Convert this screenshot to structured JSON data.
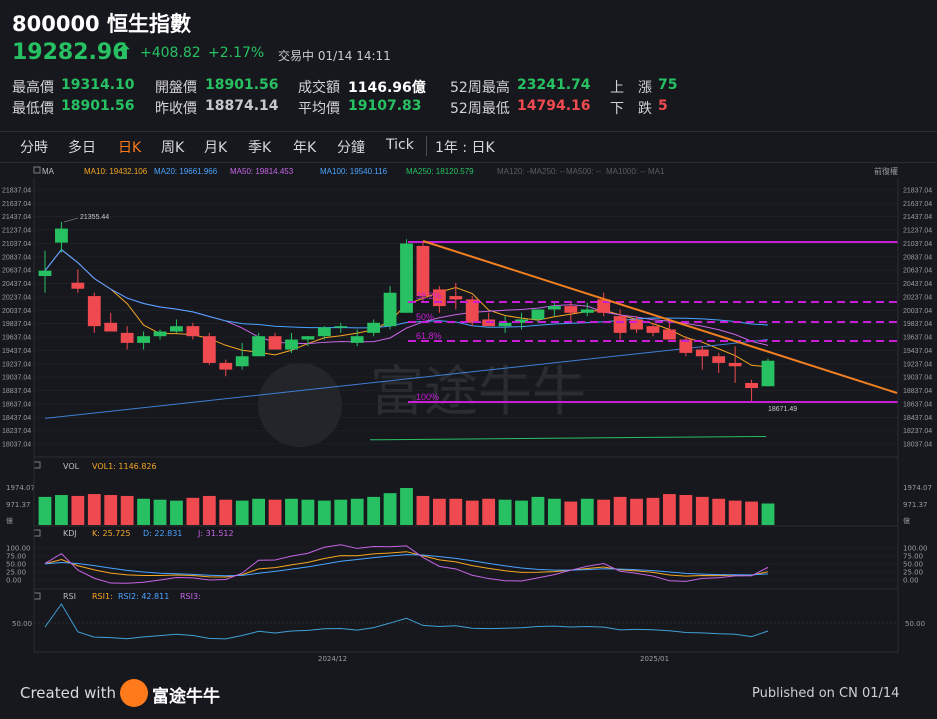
{
  "header": {
    "code": "800000",
    "name": "恒生指數",
    "price": "19282.96",
    "change": "+408.82",
    "change_pct": "+2.17%",
    "status": "交易中 01/14 14:11"
  },
  "stats": {
    "high_label": "最高價",
    "high": "19314.10",
    "low_label": "最低價",
    "low": "18901.56",
    "open_label": "開盤價",
    "open": "18901.56",
    "prev_label": "昨收價",
    "prev": "18874.14",
    "turnover_label": "成交額",
    "turnover": "1146.96億",
    "avg_label": "平均價",
    "avg": "19107.83",
    "w52h_label": "52周最高",
    "w52h": "23241.74",
    "w52l_label": "52周最低",
    "w52l": "14794.16",
    "up_label": "上　漲",
    "up": "75",
    "down_label": "下　跌",
    "down": "5"
  },
  "tabs": [
    "分時",
    "多日",
    "日K",
    "周K",
    "月K",
    "季K",
    "年K",
    "分鐘",
    "Tick"
  ],
  "active_tab": "日K",
  "range_label": "1年 : 日K",
  "indicators": {
    "ma_title": "MA",
    "ma10": "MA10: 19432.106",
    "ma20": "MA20: 19661.966",
    "ma50": "MA50: 19814.453",
    "ma100": "MA100: 19540.116",
    "ma250": "MA250: 18120.579",
    "ma120": "MA120: --",
    "ma250b": "MA250: --",
    "ma500": "MA500: --",
    "ma1000": "MA1000: --",
    "ma_extra": "MA1",
    "fq": "前復權",
    "vol_title": "VOL",
    "vol1": "VOL1: 1146.826",
    "kdj_title": "KDJ",
    "k": "K: 25.725",
    "d": "D: 22.831",
    "j": "J: 31.512",
    "rsi_title": "RSI",
    "rsi1": "RSI1:",
    "rsi2": "RSI2: 42.811",
    "rsi3": "RSI3:"
  },
  "price_ticks": [
    "21837.04",
    "21637.04",
    "21437.04",
    "21237.04",
    "21037.04",
    "20837.04",
    "20637.04",
    "20437.04",
    "20237.04",
    "20037.04",
    "19837.04",
    "19637.04",
    "19437.04",
    "19237.04",
    "19037.04",
    "18837.04",
    "18637.04",
    "18437.04",
    "18237.04",
    "18037.04"
  ],
  "vol_ticks": [
    "1974.07",
    "971.37",
    "億"
  ],
  "kdj_ticks": [
    "100.00",
    "75.00",
    "50.00",
    "25.00",
    "0.00"
  ],
  "rsi_ticks": [
    "50.00"
  ],
  "date_labels": [
    "2024/12",
    "2025/01"
  ],
  "fib_labels": [
    "38.2%",
    "50%",
    "61.8%",
    "100%"
  ],
  "annotations": {
    "high_mark": "21355.44",
    "low_mark": "18671.49"
  },
  "watermark": "富途牛牛",
  "footer": {
    "created": "Created with",
    "brand": "富途牛牛",
    "published": "Published on CN 01/14"
  },
  "colors": {
    "up": "#ef4a4f",
    "down": "#27c062",
    "accent": "#ff7a1a",
    "fib": "#c81ed6"
  },
  "chart_data": {
    "type": "candlestick",
    "ohlc": [
      [
        20550,
        20930,
        20300,
        20630
      ],
      [
        21050,
        21360,
        20900,
        21260
      ],
      [
        20450,
        20650,
        20300,
        20360
      ],
      [
        20250,
        20300,
        19700,
        19800
      ],
      [
        19850,
        20000,
        19780,
        19720
      ],
      [
        19700,
        19800,
        19450,
        19550
      ],
      [
        19550,
        19720,
        19450,
        19650
      ],
      [
        19650,
        19750,
        19600,
        19720
      ],
      [
        19720,
        19900,
        19700,
        19800
      ],
      [
        19800,
        19850,
        19600,
        19650
      ],
      [
        19650,
        19700,
        19220,
        19250
      ],
      [
        19250,
        19300,
        19050,
        19150
      ],
      [
        19200,
        19550,
        19150,
        19350
      ],
      [
        19350,
        19700,
        19350,
        19650
      ],
      [
        19650,
        19700,
        19500,
        19450
      ],
      [
        19450,
        19700,
        19400,
        19600
      ],
      [
        19600,
        19650,
        19500,
        19650
      ],
      [
        19650,
        19800,
        19600,
        19780
      ],
      [
        19780,
        19850,
        19700,
        19800
      ],
      [
        19550,
        19750,
        19500,
        19650
      ],
      [
        19700,
        19900,
        19650,
        19850
      ],
      [
        19800,
        20400,
        19750,
        20300
      ],
      [
        20000,
        21100,
        20000,
        21037
      ],
      [
        21000,
        21050,
        20150,
        20250
      ],
      [
        20350,
        20400,
        20000,
        20100
      ],
      [
        20250,
        20450,
        20050,
        20200
      ],
      [
        20200,
        20250,
        19800,
        19850
      ],
      [
        19900,
        20000,
        19800,
        19800
      ],
      [
        19800,
        19950,
        19700,
        19850
      ],
      [
        19850,
        20000,
        19750,
        19900
      ],
      [
        19900,
        20050,
        19850,
        20050
      ],
      [
        20050,
        20150,
        19950,
        20100
      ],
      [
        20100,
        20150,
        19850,
        20000
      ],
      [
        20000,
        20150,
        19950,
        20050
      ],
      [
        20200,
        20300,
        19950,
        20000
      ],
      [
        19950,
        20050,
        19600,
        19700
      ],
      [
        19900,
        19950,
        19700,
        19750
      ],
      [
        19800,
        19850,
        19650,
        19700
      ],
      [
        19750,
        19850,
        19600,
        19600
      ],
      [
        19600,
        19650,
        19350,
        19400
      ],
      [
        19450,
        19500,
        19150,
        19350
      ],
      [
        19350,
        19400,
        19100,
        19250
      ],
      [
        19250,
        19500,
        18950,
        19200
      ],
      [
        18950,
        19000,
        18671,
        18874
      ],
      [
        18901,
        19314,
        18901,
        19283
      ]
    ],
    "volume": [
      1500,
      1600,
      1550,
      1650,
      1600,
      1550,
      1400,
      1350,
      1300,
      1450,
      1550,
      1350,
      1300,
      1400,
      1350,
      1400,
      1350,
      1300,
      1350,
      1400,
      1500,
      1700,
      1974,
      1550,
      1400,
      1400,
      1300,
      1400,
      1350,
      1300,
      1500,
      1400,
      1250,
      1400,
      1350,
      1500,
      1400,
      1450,
      1650,
      1600,
      1500,
      1400,
      1300,
      1250,
      1147
    ],
    "x_labels": [
      "2024/12",
      "2025/01"
    ],
    "ylim": [
      18037.04,
      21837.04
    ]
  }
}
